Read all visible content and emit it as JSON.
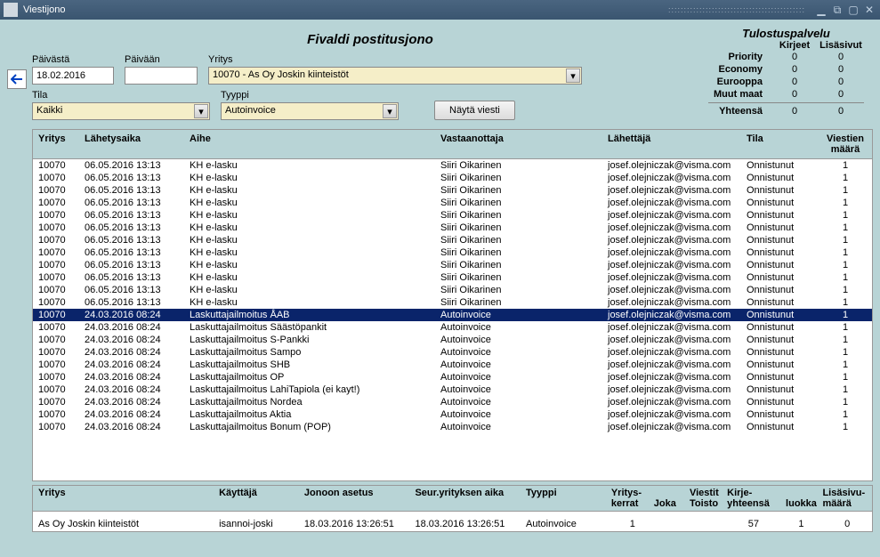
{
  "window": {
    "title": "Viestijono"
  },
  "page_title": "Fivaldi postitusjono",
  "stats": {
    "title": "Tulostuspalvelu",
    "col1": "Kirjeet",
    "col2": "Lisäsivut",
    "rows": [
      {
        "label": "Priority",
        "v1": "0",
        "v2": "0"
      },
      {
        "label": "Economy",
        "v1": "0",
        "v2": "0"
      },
      {
        "label": "Eurooppa",
        "v1": "0",
        "v2": "0"
      },
      {
        "label": "Muut maat",
        "v1": "0",
        "v2": "0"
      },
      {
        "label": "Yhteensä",
        "v1": "0",
        "v2": "0"
      }
    ]
  },
  "filters": {
    "paivasta_label": "Päivästä",
    "paivasta_value": "18.02.2016",
    "paivaan_label": "Päivään",
    "paivaan_value": "",
    "yritys_label": "Yritys",
    "yritys_value": "10070 - As Oy Joskin kiinteistöt",
    "tila_label": "Tila",
    "tila_value": "Kaikki",
    "tyyppi_label": "Tyyppi",
    "tyyppi_value": "Autoinvoice",
    "nayta_btn": "Näytä viesti"
  },
  "grid": {
    "headers": {
      "yritys": "Yritys",
      "lahetysaika": "Lähetysaika",
      "aihe": "Aihe",
      "vastaanottaja": "Vastaanottaja",
      "lahettaja": "Lähettäjä",
      "tila": "Tila",
      "viestien_maara": "Viestien  määrä"
    },
    "rows": [
      {
        "yr": "10070",
        "la": "06.05.2016 13:13",
        "ai": "KH e-lasku",
        "va": "Siiri Oikarinen",
        "lh": "josef.olejniczak@visma.com",
        "ti": "Onnistunut",
        "vm": "1",
        "sel": false
      },
      {
        "yr": "10070",
        "la": "06.05.2016 13:13",
        "ai": "KH e-lasku",
        "va": "Siiri Oikarinen",
        "lh": "josef.olejniczak@visma.com",
        "ti": "Onnistunut",
        "vm": "1",
        "sel": false
      },
      {
        "yr": "10070",
        "la": "06.05.2016 13:13",
        "ai": "KH e-lasku",
        "va": "Siiri Oikarinen",
        "lh": "josef.olejniczak@visma.com",
        "ti": "Onnistunut",
        "vm": "1",
        "sel": false
      },
      {
        "yr": "10070",
        "la": "06.05.2016 13:13",
        "ai": "KH e-lasku",
        "va": "Siiri Oikarinen",
        "lh": "josef.olejniczak@visma.com",
        "ti": "Onnistunut",
        "vm": "1",
        "sel": false
      },
      {
        "yr": "10070",
        "la": "06.05.2016 13:13",
        "ai": "KH e-lasku",
        "va": "Siiri Oikarinen",
        "lh": "josef.olejniczak@visma.com",
        "ti": "Onnistunut",
        "vm": "1",
        "sel": false
      },
      {
        "yr": "10070",
        "la": "06.05.2016 13:13",
        "ai": "KH e-lasku",
        "va": "Siiri Oikarinen",
        "lh": "josef.olejniczak@visma.com",
        "ti": "Onnistunut",
        "vm": "1",
        "sel": false
      },
      {
        "yr": "10070",
        "la": "06.05.2016 13:13",
        "ai": "KH e-lasku",
        "va": "Siiri Oikarinen",
        "lh": "josef.olejniczak@visma.com",
        "ti": "Onnistunut",
        "vm": "1",
        "sel": false
      },
      {
        "yr": "10070",
        "la": "06.05.2016 13:13",
        "ai": "KH e-lasku",
        "va": "Siiri Oikarinen",
        "lh": "josef.olejniczak@visma.com",
        "ti": "Onnistunut",
        "vm": "1",
        "sel": false
      },
      {
        "yr": "10070",
        "la": "06.05.2016 13:13",
        "ai": "KH e-lasku",
        "va": "Siiri Oikarinen",
        "lh": "josef.olejniczak@visma.com",
        "ti": "Onnistunut",
        "vm": "1",
        "sel": false
      },
      {
        "yr": "10070",
        "la": "06.05.2016 13:13",
        "ai": "KH e-lasku",
        "va": "Siiri Oikarinen",
        "lh": "josef.olejniczak@visma.com",
        "ti": "Onnistunut",
        "vm": "1",
        "sel": false
      },
      {
        "yr": "10070",
        "la": "06.05.2016 13:13",
        "ai": "KH e-lasku",
        "va": "Siiri Oikarinen",
        "lh": "josef.olejniczak@visma.com",
        "ti": "Onnistunut",
        "vm": "1",
        "sel": false
      },
      {
        "yr": "10070",
        "la": "06.05.2016 13:13",
        "ai": "KH e-lasku",
        "va": "Siiri Oikarinen",
        "lh": "josef.olejniczak@visma.com",
        "ti": "Onnistunut",
        "vm": "1",
        "sel": false
      },
      {
        "yr": "10070",
        "la": "24.03.2016 08:24",
        "ai": "Laskuttajailmoitus ÅAB",
        "va": "Autoinvoice",
        "lh": "josef.olejniczak@visma.com",
        "ti": "Onnistunut",
        "vm": "1",
        "sel": true
      },
      {
        "yr": "10070",
        "la": "24.03.2016 08:24",
        "ai": "Laskuttajailmoitus Säästöpankit",
        "va": "Autoinvoice",
        "lh": "josef.olejniczak@visma.com",
        "ti": "Onnistunut",
        "vm": "1",
        "sel": false
      },
      {
        "yr": "10070",
        "la": "24.03.2016 08:24",
        "ai": "Laskuttajailmoitus S-Pankki",
        "va": "Autoinvoice",
        "lh": "josef.olejniczak@visma.com",
        "ti": "Onnistunut",
        "vm": "1",
        "sel": false
      },
      {
        "yr": "10070",
        "la": "24.03.2016 08:24",
        "ai": "Laskuttajailmoitus Sampo",
        "va": "Autoinvoice",
        "lh": "josef.olejniczak@visma.com",
        "ti": "Onnistunut",
        "vm": "1",
        "sel": false
      },
      {
        "yr": "10070",
        "la": "24.03.2016 08:24",
        "ai": "Laskuttajailmoitus SHB",
        "va": "Autoinvoice",
        "lh": "josef.olejniczak@visma.com",
        "ti": "Onnistunut",
        "vm": "1",
        "sel": false
      },
      {
        "yr": "10070",
        "la": "24.03.2016 08:24",
        "ai": "Laskuttajailmoitus OP",
        "va": "Autoinvoice",
        "lh": "josef.olejniczak@visma.com",
        "ti": "Onnistunut",
        "vm": "1",
        "sel": false
      },
      {
        "yr": "10070",
        "la": "24.03.2016 08:24",
        "ai": "Laskuttajailmoitus LahiTapiola (ei kayt!)",
        "va": "Autoinvoice",
        "lh": "josef.olejniczak@visma.com",
        "ti": "Onnistunut",
        "vm": "1",
        "sel": false
      },
      {
        "yr": "10070",
        "la": "24.03.2016 08:24",
        "ai": "Laskuttajailmoitus Nordea",
        "va": "Autoinvoice",
        "lh": "josef.olejniczak@visma.com",
        "ti": "Onnistunut",
        "vm": "1",
        "sel": false
      },
      {
        "yr": "10070",
        "la": "24.03.2016 08:24",
        "ai": "Laskuttajailmoitus Aktia",
        "va": "Autoinvoice",
        "lh": "josef.olejniczak@visma.com",
        "ti": "Onnistunut",
        "vm": "1",
        "sel": false
      },
      {
        "yr": "10070",
        "la": "24.03.2016 08:24",
        "ai": "Laskuttajailmoitus Bonum (POP)",
        "va": "Autoinvoice",
        "lh": "josef.olejniczak@visma.com",
        "ti": "Onnistunut",
        "vm": "1",
        "sel": false
      }
    ]
  },
  "summary": {
    "headers": {
      "yritys": "Yritys",
      "kayttaja": "Käyttäjä",
      "jonoon_asetus": "Jonoon asetus",
      "seur_aika": "Seur.yrityksen aika",
      "tyyppi": "Tyyppi",
      "yritys_kerrat_1": "Yritys-",
      "yritys_kerrat_2": "kerrat",
      "joka": "Joka",
      "viestit_1": "Viestit",
      "viestit_2": "Toisto",
      "kirje_1": "Kirje-",
      "kirje_2": "yhteensä",
      "luokka": "luokka",
      "lisasivu_1": "Lisäsivu-",
      "lisasivu_2": "määrä"
    },
    "row": {
      "yritys": "As Oy Joskin kiinteistöt",
      "kayttaja": "isannoi-joski",
      "jonoon": "18.03.2016 13:26:51",
      "seur": "18.03.2016 13:26:51",
      "tyyppi": "Autoinvoice",
      "kerrat": "1",
      "joka": "",
      "toisto": "",
      "yhteensa": "57",
      "luokka": "1",
      "lisasivu": "0"
    }
  }
}
